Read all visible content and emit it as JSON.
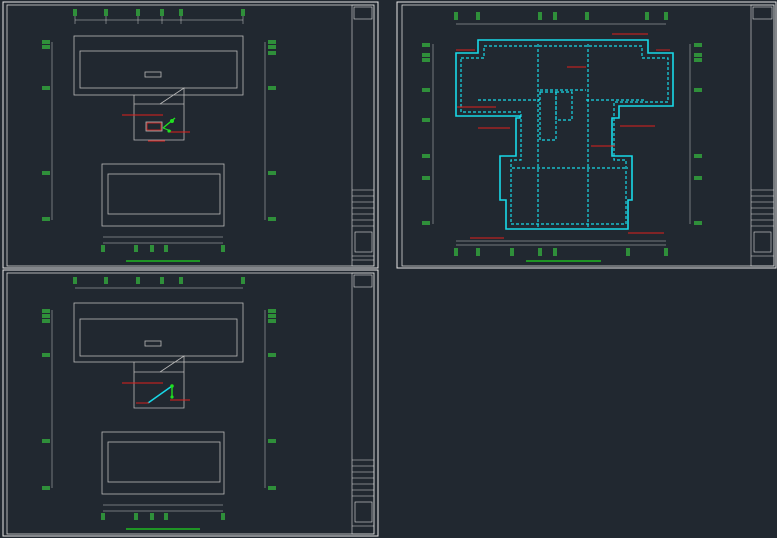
{
  "window": {
    "title": ""
  },
  "sheets": [
    {
      "id": "sheet-1"
    },
    {
      "id": "sheet-2"
    },
    {
      "id": "sheet-3"
    }
  ],
  "colors": {
    "background": "#212830",
    "frame": "#e6e6e6",
    "grid_bubble": "#2f8f3a",
    "highlight_cyan": "#18d9e8",
    "red_leader": "#e0201c",
    "scale_bar": "#1fd51f"
  }
}
